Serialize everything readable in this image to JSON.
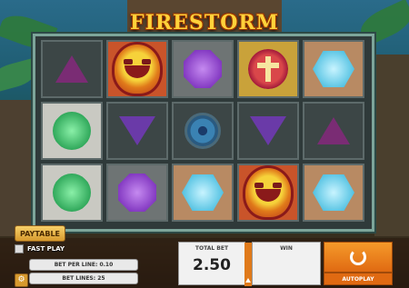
{
  "game": {
    "title": "FIRESTORM"
  },
  "reels": {
    "rows": [
      [
        {
          "symbol": "purple-triangle-icon",
          "tile": "t-dark"
        },
        {
          "symbol": "sun-mask-icon",
          "tile": "t-red"
        },
        {
          "symbol": "purple-gem-icon",
          "tile": "t-gray"
        },
        {
          "symbol": "ruby-cross-icon",
          "tile": "t-gold"
        },
        {
          "symbol": "blue-gem-icon",
          "tile": "t-tan"
        }
      ],
      [
        {
          "symbol": "green-gem-icon",
          "tile": "t-white"
        },
        {
          "symbol": "purple-triangle-down-icon",
          "tile": "t-dark"
        },
        {
          "symbol": "blue-orb-icon",
          "tile": "t-dark"
        },
        {
          "symbol": "purple-triangle-down-icon",
          "tile": "t-dark"
        },
        {
          "symbol": "purple-triangle-icon",
          "tile": "t-dark"
        }
      ],
      [
        {
          "symbol": "green-gem-icon",
          "tile": "t-white"
        },
        {
          "symbol": "purple-gem-icon",
          "tile": "t-gray"
        },
        {
          "symbol": "blue-gem-icon",
          "tile": "t-tan"
        },
        {
          "symbol": "sun-mask-icon",
          "tile": "t-red"
        },
        {
          "symbol": "blue-gem-icon",
          "tile": "t-tan"
        }
      ]
    ]
  },
  "controls": {
    "paytable_label": "PAYTABLE",
    "fastplay_label": "FAST PLAY",
    "bet_per_line": "BET PER LINE: 0.10",
    "bet_lines": "BET LINES: 25",
    "total_bet_label": "TOTAL BET",
    "total_bet_value": "2.50",
    "win_label": "WIN",
    "autoplay_label": "AUTOPLAY"
  },
  "colors": {
    "accent": "#e06a12",
    "logo": "#ffd23a",
    "frame": "#7da59a"
  }
}
